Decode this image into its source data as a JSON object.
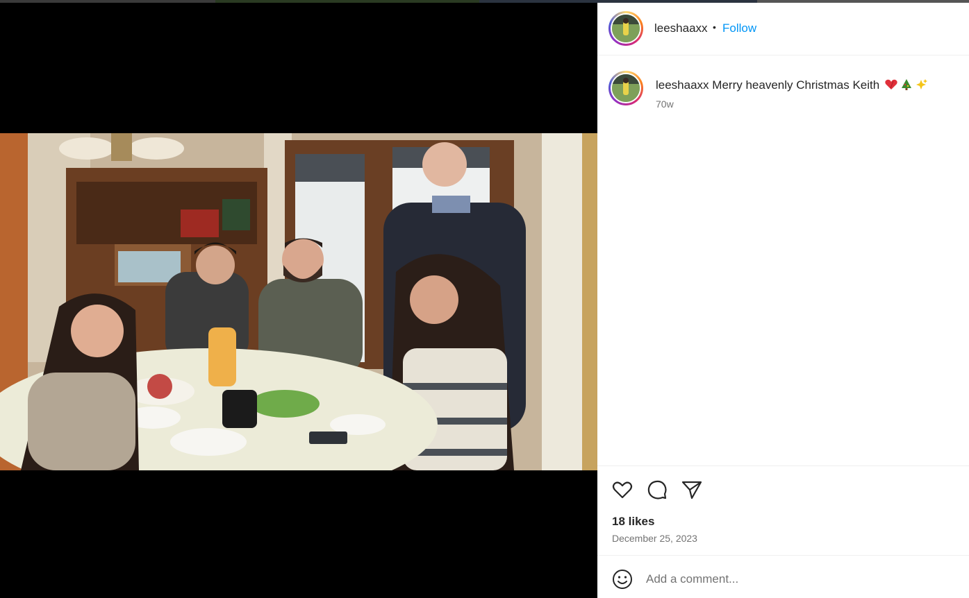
{
  "post": {
    "username": "leeshaaxx",
    "separator": "•",
    "follow_label": "Follow",
    "caption_text": "Merry heavenly Christmas Keith",
    "caption_emojis": [
      "heart-emoji",
      "christmas-tree-emoji",
      "sparkles-emoji"
    ],
    "time_ago": "70w",
    "likes": "18 likes",
    "date": "December 25, 2023"
  },
  "actions": {
    "icons": [
      "heart-icon",
      "comment-icon",
      "share-icon"
    ]
  },
  "comment": {
    "placeholder": "Add a comment...",
    "emoji_icon": "smiley-icon"
  },
  "colors": {
    "accent": "#0095f6",
    "muted": "#737373",
    "text": "#262626"
  }
}
